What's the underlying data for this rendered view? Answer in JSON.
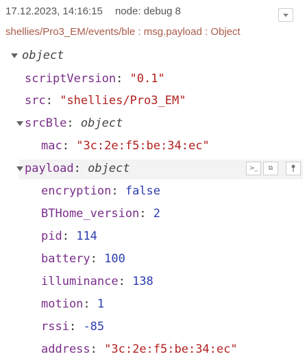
{
  "header": {
    "timestamp": "17.12.2023, 14:16:15",
    "node": "node: debug 8"
  },
  "topic": "shellies/Pro3_EM/events/ble : msg.payload : Object",
  "tree": {
    "root_type": "object",
    "scriptVersion": {
      "key": "scriptVersion",
      "value": "\"0.1\""
    },
    "src": {
      "key": "src",
      "value": "\"shellies/Pro3_EM\""
    },
    "srcBle": {
      "key": "srcBle",
      "type": "object",
      "mac": {
        "key": "mac",
        "value": "\"3c:2e:f5:be:34:ec\""
      }
    },
    "payload": {
      "key": "payload",
      "type": "object",
      "encryption": {
        "key": "encryption",
        "value": "false"
      },
      "BTHome_version": {
        "key": "BTHome_version",
        "value": "2"
      },
      "pid": {
        "key": "pid",
        "value": "114"
      },
      "battery": {
        "key": "battery",
        "value": "100"
      },
      "illuminance": {
        "key": "illuminance",
        "value": "138"
      },
      "motion": {
        "key": "motion",
        "value": "1"
      },
      "rssi": {
        "key": "rssi",
        "value": "-85"
      },
      "address": {
        "key": "address",
        "value": "\"3c:2e:f5:be:34:ec\""
      }
    }
  },
  "toolbar": {
    "copy_path_icon": ">_",
    "copy_value_icon": "⧉",
    "pin_icon": "📌"
  },
  "colors": {
    "key": "#7a2d8a",
    "string": "#b22020",
    "number": "#2a3cb0",
    "topic": "#aa5b49"
  }
}
